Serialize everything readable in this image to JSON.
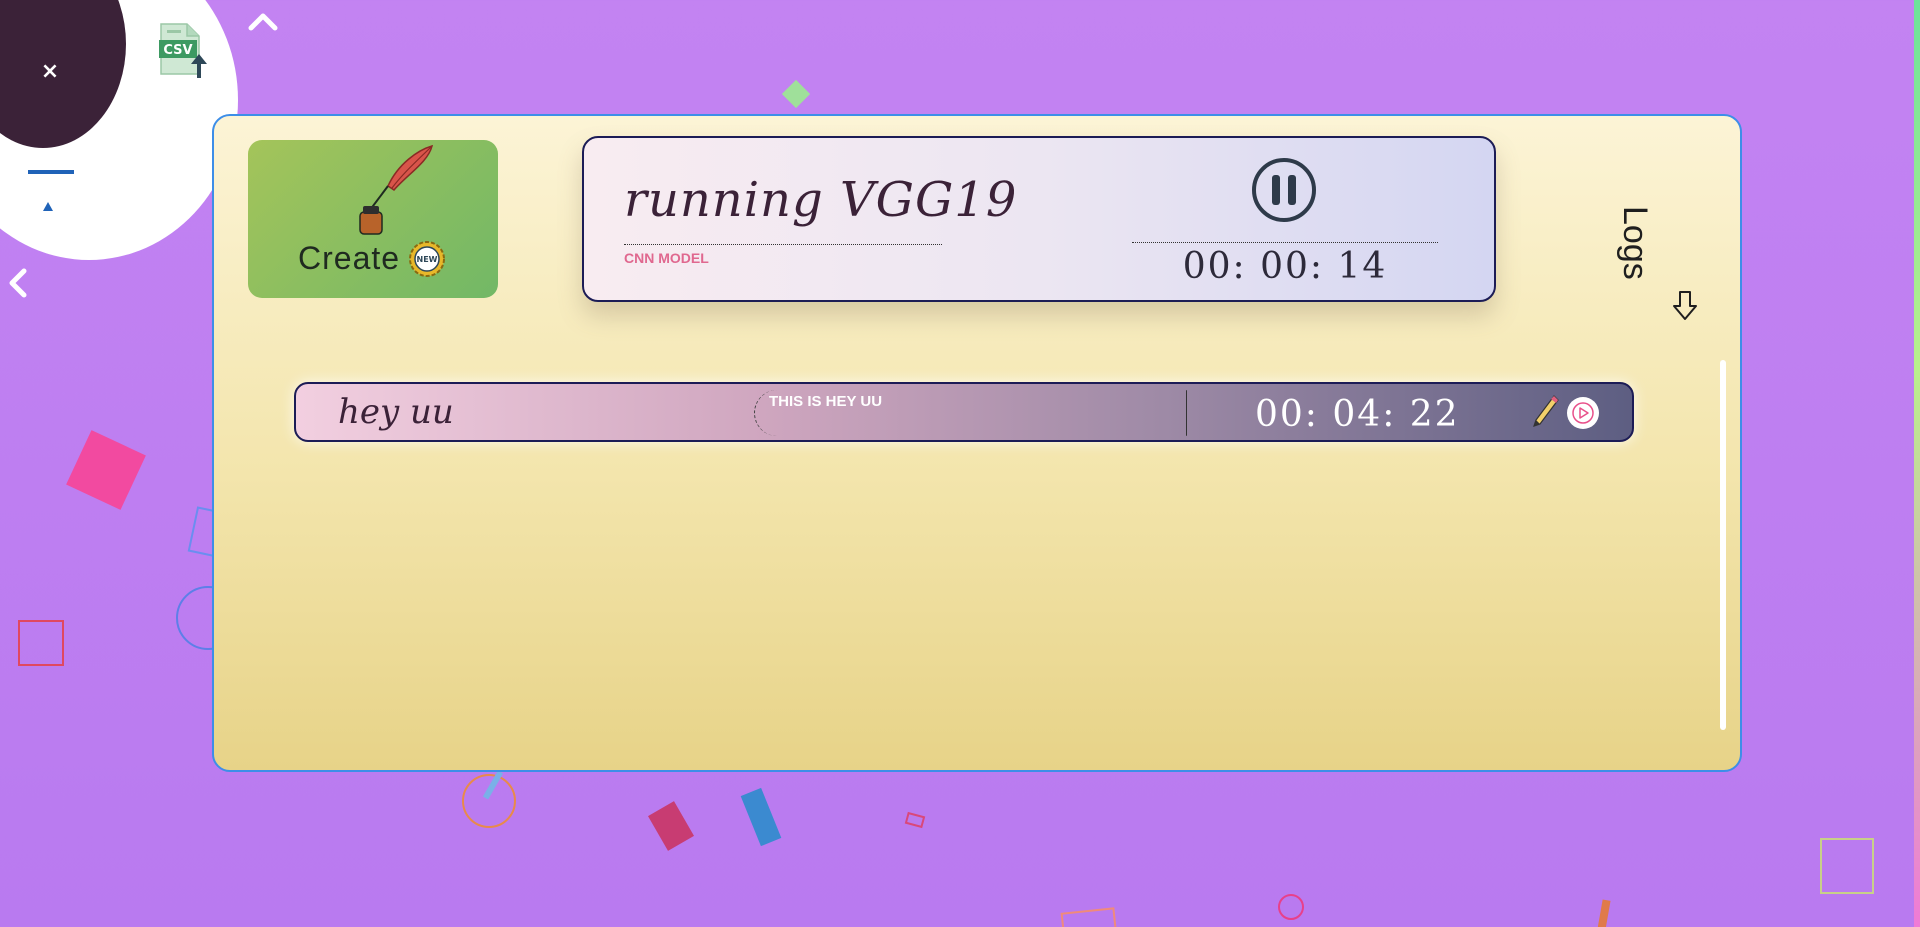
{
  "corner_menu": {
    "close_label": "×",
    "csv_badge": "CSV",
    "icons": [
      "close-icon",
      "csv-upload-icon",
      "minus-icon",
      "triangle-up-icon"
    ]
  },
  "nav": {
    "up_icon": "chevron-up-icon",
    "left_icon": "chevron-left-icon"
  },
  "create_card": {
    "label": "Create",
    "badge": "NEW",
    "icon": "quill-ink-icon"
  },
  "running": {
    "title": "running VGG19",
    "subtitle": "CNN MODEL",
    "timer": "00: 00: 14",
    "pause_icon": "pause-icon"
  },
  "logs": {
    "label": "Logs",
    "icon": "arrow-down-icon"
  },
  "tasks": [
    {
      "name": "hey uu",
      "description": "THIS IS HEY UU",
      "timer": "00: 04: 22",
      "edit_icon": "pencil-icon",
      "play_icon": "play-icon"
    }
  ],
  "colors": {
    "background": "#c383f2",
    "panel_border": "#3d8ee8",
    "accent_pink": "#e0688f",
    "dark_ink": "#3b2238",
    "navy_border": "#1c1c56"
  }
}
